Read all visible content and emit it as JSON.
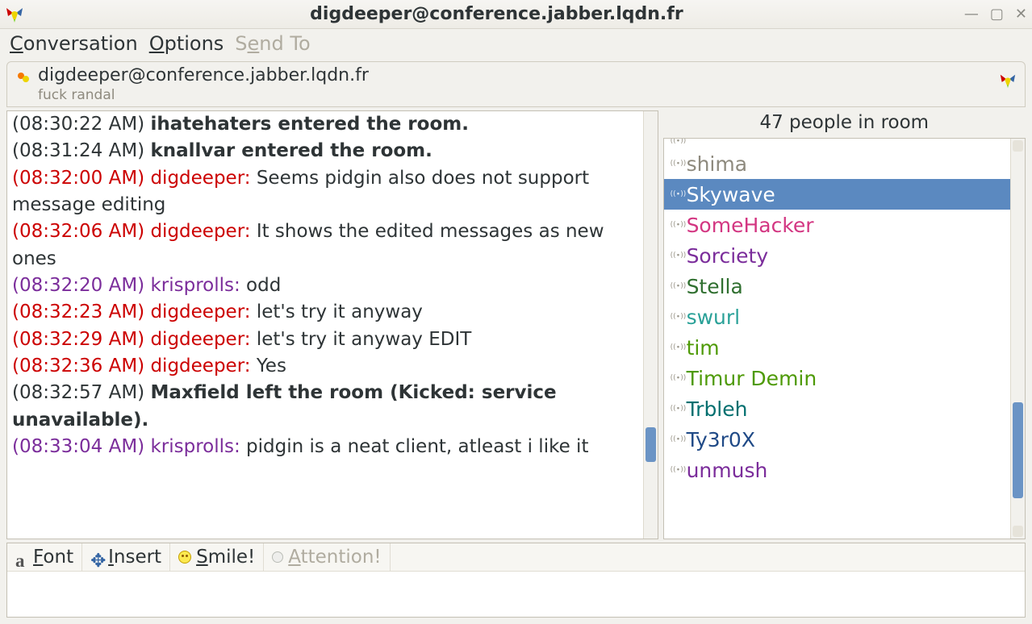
{
  "window": {
    "title": "digdeeper@conference.jabber.lqdn.fr"
  },
  "menu": {
    "conversation": "Conversation",
    "options": "Options",
    "send_to": "Send To"
  },
  "header": {
    "room": "digdeeper@conference.jabber.lqdn.fr",
    "topic": "fuck randal"
  },
  "roster": {
    "count_label": "47 people in room",
    "items": [
      {
        "name": "",
        "color": "nm-blue",
        "cutoff": true
      },
      {
        "name": "shima",
        "color": "nm-gray"
      },
      {
        "name": "Skywave",
        "color": "",
        "selected": true
      },
      {
        "name": "SomeHacker",
        "color": "nm-pink"
      },
      {
        "name": "Sorciety",
        "color": "nm-purple"
      },
      {
        "name": "Stella",
        "color": "nm-dgreen"
      },
      {
        "name": "swurl",
        "color": "nm-cyan"
      },
      {
        "name": "tim",
        "color": "nm-green"
      },
      {
        "name": "Timur Demin",
        "color": "nm-green"
      },
      {
        "name": "Trbleh",
        "color": "nm-teal"
      },
      {
        "name": "Ty3r0X",
        "color": "nm-navy"
      },
      {
        "name": "unmush",
        "color": "nm-purple"
      }
    ]
  },
  "messages": [
    {
      "ts": "(08:30:22 AM)",
      "kind": "system",
      "text": "ihatehaters entered the room."
    },
    {
      "ts": "(08:31:24 AM)",
      "kind": "system",
      "text": "knallvar entered the room."
    },
    {
      "ts": "(08:32:00 AM)",
      "kind": "msg",
      "ts_class": "ts-red",
      "nick": "digdeeper:",
      "nick_class": "nick-red",
      "text": "Seems pidgin also does not support message editing"
    },
    {
      "ts": "(08:32:06 AM)",
      "kind": "msg",
      "ts_class": "ts-red",
      "nick": "digdeeper:",
      "nick_class": "nick-red",
      "text": "It shows the edited messages as new ones"
    },
    {
      "ts": "(08:32:20 AM)",
      "kind": "msg",
      "ts_class": "ts-purple",
      "nick": "krisprolls:",
      "nick_class": "nick-purple",
      "text": "odd"
    },
    {
      "ts": "(08:32:23 AM)",
      "kind": "msg",
      "ts_class": "ts-red",
      "nick": "digdeeper:",
      "nick_class": "nick-red",
      "text": "let's try it anyway"
    },
    {
      "ts": "(08:32:29 AM)",
      "kind": "msg",
      "ts_class": "ts-red",
      "nick": "digdeeper:",
      "nick_class": "nick-red",
      "text": "let's try it anyway EDIT"
    },
    {
      "ts": "(08:32:36 AM)",
      "kind": "msg",
      "ts_class": "ts-red",
      "nick": "digdeeper:",
      "nick_class": "nick-red",
      "text": "Yes"
    },
    {
      "ts": "(08:32:57 AM)",
      "kind": "system",
      "text": "Maxfield left the room (Kicked: service unavailable)."
    },
    {
      "ts": "(08:33:04 AM)",
      "kind": "msg",
      "ts_class": "ts-purple",
      "nick": "krisprolls:",
      "nick_class": "nick-purple",
      "text": "pidgin is a neat client, atleast i like it"
    }
  ],
  "toolbar": {
    "font": "Font",
    "insert": "Insert",
    "smile": "Smile!",
    "attention": "Attention!"
  }
}
